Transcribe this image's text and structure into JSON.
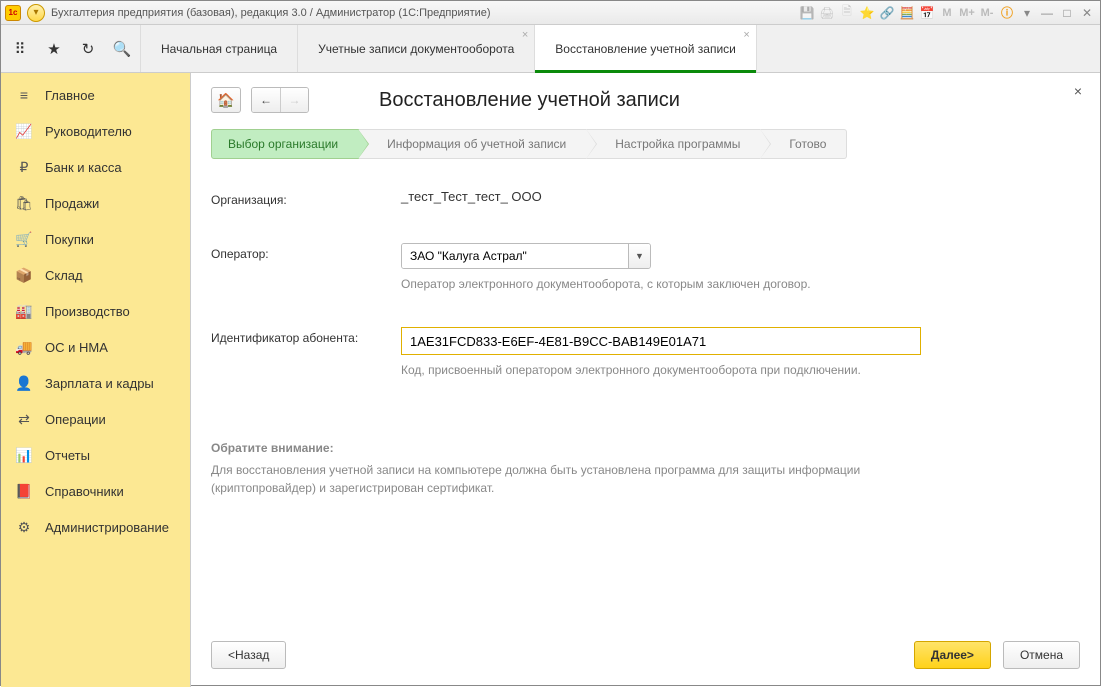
{
  "titlebar": {
    "logo": "1с",
    "title": "Бухгалтерия предприятия (базовая), редакция 3.0 / Администратор  (1С:Предприятие)",
    "m1": "M",
    "m2": "M+",
    "m3": "M-"
  },
  "tabs": {
    "items": [
      {
        "label": "Начальная страница",
        "closable": false
      },
      {
        "label": "Учетные записи документооборота",
        "closable": true
      },
      {
        "label": "Восстановление учетной записи",
        "closable": true
      }
    ]
  },
  "sidebar": {
    "items": [
      {
        "icon": "≡",
        "label": "Главное"
      },
      {
        "icon": "📈",
        "label": "Руководителю"
      },
      {
        "icon": "₽",
        "label": "Банк и касса"
      },
      {
        "icon": "🛍",
        "label": "Продажи"
      },
      {
        "icon": "🛒",
        "label": "Покупки"
      },
      {
        "icon": "📦",
        "label": "Склад"
      },
      {
        "icon": "🏭",
        "label": "Производство"
      },
      {
        "icon": "🚚",
        "label": "ОС и НМА"
      },
      {
        "icon": "👤",
        "label": "Зарплата и кадры"
      },
      {
        "icon": "⇄",
        "label": "Операции"
      },
      {
        "icon": "📊",
        "label": "Отчеты"
      },
      {
        "icon": "📕",
        "label": "Справочники"
      },
      {
        "icon": "⚙",
        "label": "Администрирование"
      }
    ]
  },
  "content": {
    "page_title": "Восстановление учетной записи",
    "wizard": [
      "Выбор организации",
      "Информация об учетной записи",
      "Настройка программы",
      "Готово"
    ],
    "org_label": "Организация:",
    "org_value": "_тест_Тест_тест_ ООО",
    "operator_label": "Оператор:",
    "operator_value": "ЗАО \"Калуга Астрал\"",
    "operator_hint": "Оператор электронного документооборота, с которым заключен договор.",
    "id_label": "Идентификатор абонента:",
    "id_value": "1AE31FCD833-E6EF-4E81-B9CC-BAB149E01A71",
    "id_hint": "Код, присвоенный оператором электронного документооборота при подключении.",
    "note_title": "Обратите внимание:",
    "note_text": "Для восстановления учетной записи на компьютере должна быть установлена программа для защиты информации (криптопровайдер) и зарегистрирован сертификат.",
    "back_btn": "<Назад",
    "next_btn": "Далее>",
    "cancel_btn": "Отмена"
  }
}
